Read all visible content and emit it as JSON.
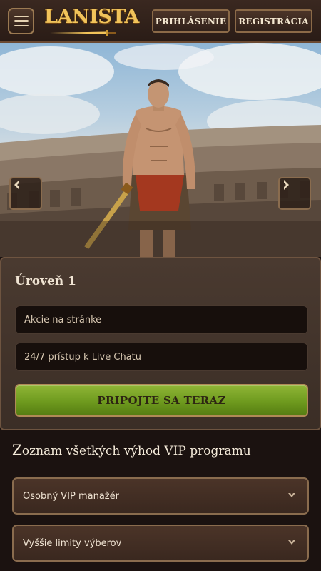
{
  "header": {
    "logo_text": "LANISTA",
    "login_label": "PRIHLÁSENIE",
    "register_label": "REGISTRÁCIA"
  },
  "hero": {
    "prev_icon": "chevron-left-icon",
    "next_icon": "chevron-right-icon"
  },
  "level": {
    "title": "Úroveň 1",
    "benefits": [
      "Akcie na stránke",
      "24/7 prístup k Live Chatu"
    ],
    "cta_label": "PRIPOJTE SA TERAZ"
  },
  "vip": {
    "heading_first": "Z",
    "heading_rest": "oznam všetkých výhod VIP programu",
    "items": [
      "Osobný VIP manažér",
      "Vyššie limity výberov"
    ]
  },
  "colors": {
    "accent_gold": "#f1c35a",
    "cta_green": "#6e9a1e",
    "background": "#1b1210",
    "panel": "#4a3a30"
  }
}
